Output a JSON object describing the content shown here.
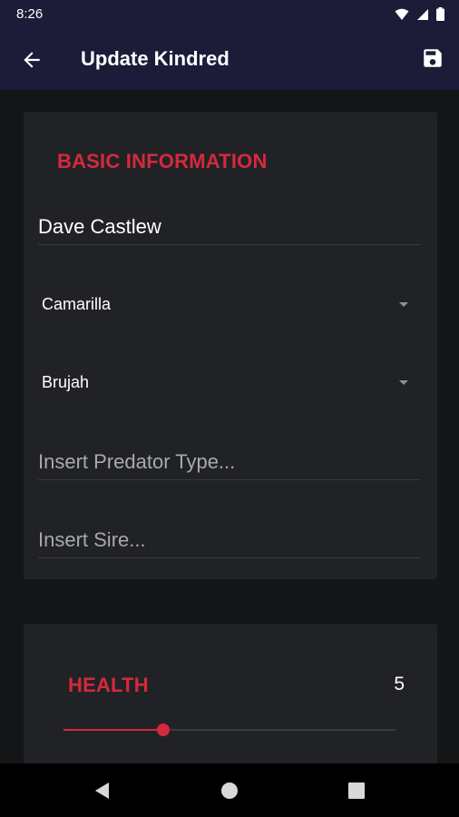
{
  "status_bar": {
    "time": "8:26",
    "icons": [
      "wifi-icon",
      "signal-icon",
      "battery-icon"
    ]
  },
  "app_bar": {
    "title": "Update Kindred",
    "back_icon": "arrow-left-icon",
    "save_icon": "save-icon"
  },
  "basic_information": {
    "title": "BASIC INFORMATION",
    "name_value": "Dave Castlew",
    "sect_selected": "Camarilla",
    "clan_selected": "Brujah",
    "predator_placeholder": "Insert Predator Type...",
    "sire_placeholder": "Insert Sire..."
  },
  "health": {
    "title": "HEALTH",
    "value": "5",
    "slider_fraction": 0.3
  },
  "nav_bar": {
    "icons": [
      "back-triangle-icon",
      "home-circle-icon",
      "recents-square-icon"
    ]
  },
  "colors": {
    "accent": "#d42a3c",
    "app_bar": "#1c1c38",
    "card": "#212226",
    "background": "#141517"
  }
}
